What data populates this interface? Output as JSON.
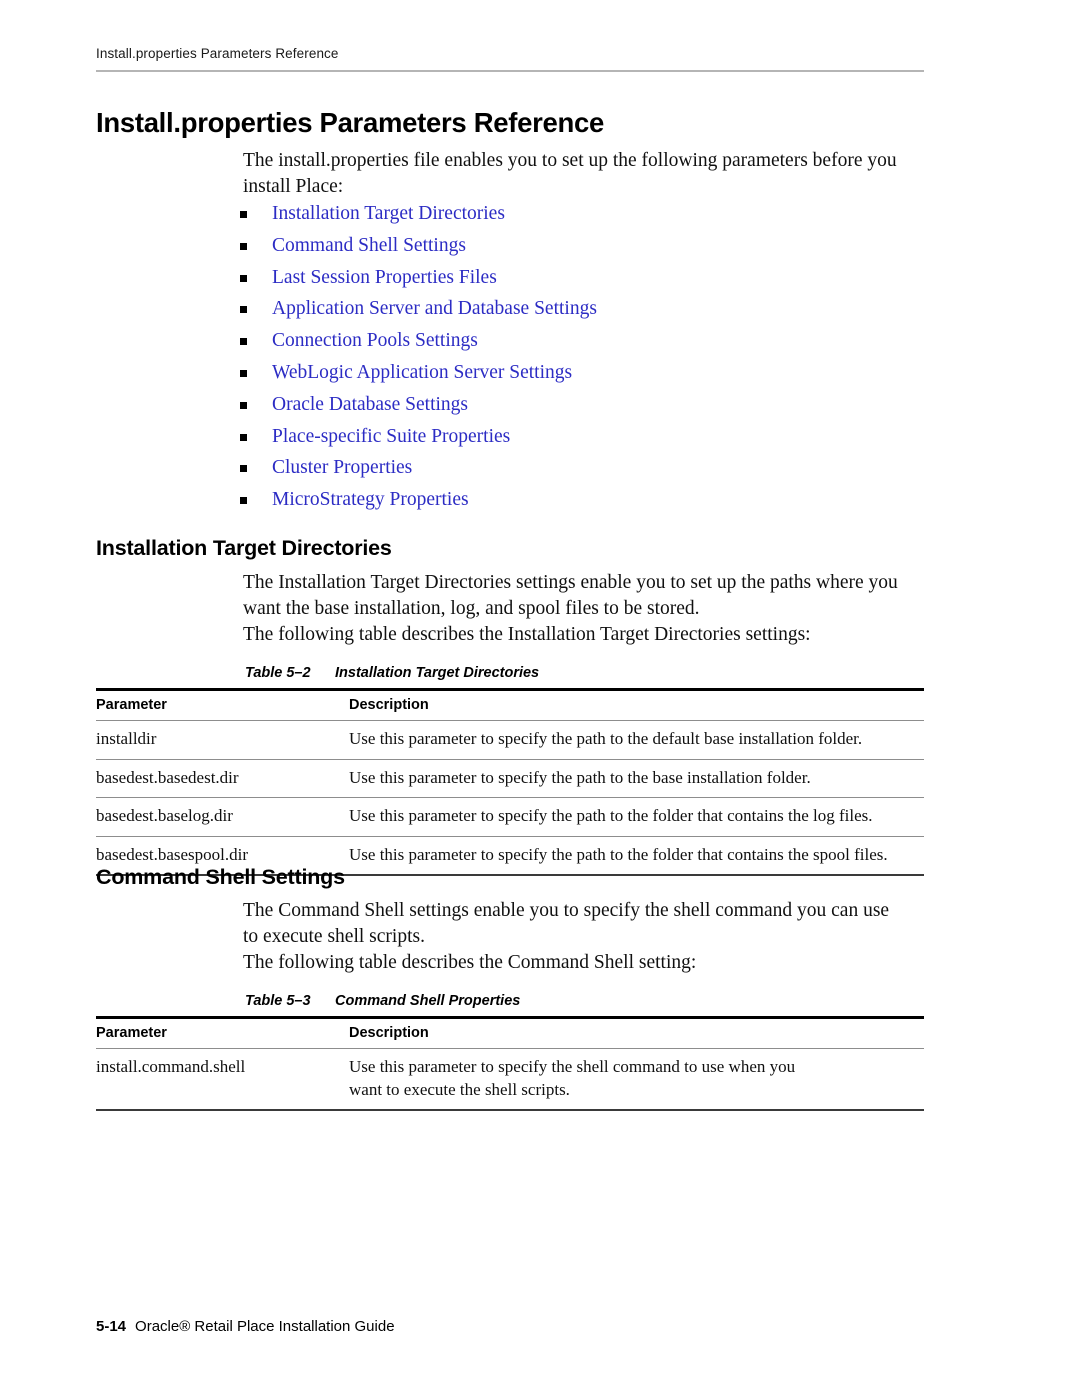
{
  "running_header": {
    "text": "Install.properties Parameters Reference"
  },
  "chapter": {
    "title": "Install.properties Parameters Reference",
    "intro": "The install.properties file enables you to set up the following parameters before you install Place:"
  },
  "toc_links": [
    {
      "label": "Installation Target Directories"
    },
    {
      "label": "Command Shell Settings"
    },
    {
      "label": "Last Session Properties Files"
    },
    {
      "label": "Application Server and Database Settings"
    },
    {
      "label": "Connection Pools Settings"
    },
    {
      "label": "WebLogic Application Server Settings"
    },
    {
      "label": "Oracle Database Settings"
    },
    {
      "label": "Place-specific Suite Properties"
    },
    {
      "label": "Cluster Properties"
    },
    {
      "label": "MicroStrategy Properties"
    }
  ],
  "sections": [
    {
      "heading": "Installation Target Directories",
      "para1": "The Installation Target Directories settings enable you to set up the paths where you want the base installation, log, and spool files to be stored.",
      "para2": "The following table describes the Installation Target Directories settings:",
      "table": {
        "caption_number": "Table 5–2",
        "caption_title": "Installation Target Directories",
        "columns": [
          "Parameter",
          "Description"
        ],
        "rows": [
          [
            "installdir",
            "Use this parameter to specify the path to the default base installation folder."
          ],
          [
            "basedest.basedest.dir",
            "Use this parameter to specify the path to the base installation folder."
          ],
          [
            "basedest.baselog.dir",
            "Use this parameter to specify the path to the folder that contains the log files."
          ],
          [
            "basedest.basespool.dir",
            "Use this parameter to specify the path to the folder that contains the spool files."
          ]
        ]
      }
    },
    {
      "heading": "Command Shell Settings",
      "para1": "The Command Shell settings enable you to specify the shell command you can use to execute shell scripts.",
      "para2": "The following table describes the Command Shell setting:",
      "table": {
        "caption_number": "Table 5–3",
        "caption_title": "Command Shell Properties",
        "columns": [
          "Parameter",
          "Description"
        ],
        "rows": [
          [
            "install.command.shell",
            "Use this parameter to specify the shell command to use when you want to execute the shell scripts."
          ]
        ]
      }
    }
  ],
  "footer": {
    "page_number": "5-14",
    "document_title": "Oracle® Retail Place Installation Guide"
  },
  "colors": {
    "link": "#2c2cc4",
    "text": "#101010",
    "rule": "#b5b5b5"
  }
}
